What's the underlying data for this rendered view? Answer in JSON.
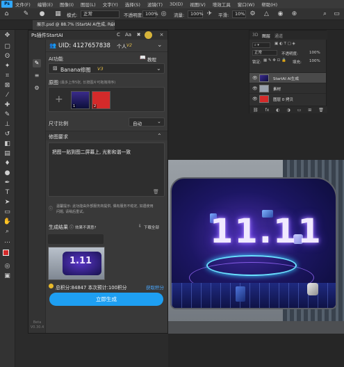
{
  "app": {
    "logo": "Ps",
    "menu": [
      "文件(F)",
      "编辑(E)",
      "图像(I)",
      "图层(L)",
      "文字(Y)",
      "选择(S)",
      "滤镜(T)",
      "3D(D)",
      "视图(V)",
      "增效工具",
      "窗口(W)",
      "帮助(H)"
    ]
  },
  "options": {
    "mode_label": "模式:",
    "mode_value": "正常",
    "opacity_label": "不透明度:",
    "opacity_value": "100%",
    "flow_label": "流量:",
    "flow_value": "100%",
    "smooth_label": "平滑:",
    "smooth_value": "10%"
  },
  "document": {
    "tab_title": "展示.psd @ 88.7% (StartAI AI生成, RGB/8#) *",
    "close": "×"
  },
  "layers_panel": {
    "tabs": [
      "3D",
      "图层",
      "通道"
    ],
    "blend_mode": "正常",
    "opacity_label": "不透明度:",
    "opacity_value": "100%",
    "lock_label": "锁定:",
    "fill_label": "填充:",
    "fill_value": "100%",
    "layers": [
      {
        "name": "StartAI AI生成",
        "selected": true
      },
      {
        "name": "素材",
        "selected": false
      },
      {
        "name": "图层 0 拷贝",
        "selected": false
      },
      {
        "name": "",
        "selected": false
      }
    ]
  },
  "plugin": {
    "title": "Ps插件StartAI",
    "titlebar_buttons": [
      "C",
      "Aa",
      "✖",
      "×"
    ],
    "version": "Beta V0.30.4",
    "uid_label": "UID: 4127657838",
    "level_label": "个人",
    "level_badge": "V2",
    "ai_function_label": "AI功能",
    "tutorial_label": "教程",
    "function_name": "Banana修图",
    "function_badge": "V3",
    "original_label": "原图",
    "original_hint": "(最多上传5张, 长按图片可拖拽排序)",
    "image_numbers": [
      "1",
      "2"
    ],
    "ratio_label": "尺寸比例",
    "ratio_value": "自动",
    "requirement_label": "修图要求",
    "requirement_text": "把图一贴到图二屏幕上, 光影和谐一致",
    "note_line1": "温馨提示: 此功能由外部服务商提供, 偶有服务不稳定, 如遇使用",
    "note_line2": "问题, 请稍后重试。",
    "result_label": "生成结果",
    "unsatisfied_label": "效果不满意?",
    "download_all_label": "下载全部",
    "result_thumb_text": "1.11",
    "credits_text": "总积分:84847  本次预计:100积分",
    "get_credits_label": "获取积分",
    "generate_label": "立即生成"
  },
  "canvas": {
    "billboard_text": "11.11"
  },
  "colors": {
    "accent": "#1e9ff2",
    "badge_gold": "#e9c24a",
    "link_blue": "#4aa8ff",
    "foreground_swatch": "#d42a2a",
    "background_swatch": "#ffffff"
  }
}
